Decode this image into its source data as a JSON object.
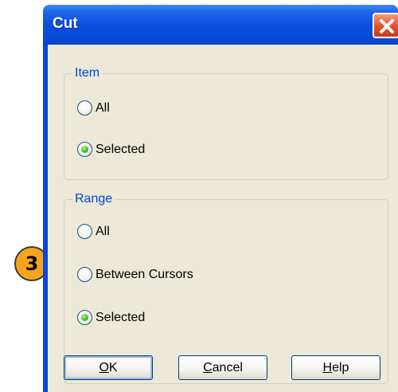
{
  "dialog": {
    "title": "Cut",
    "close_icon": "close-x-icon"
  },
  "item_group": {
    "legend": "Item",
    "options": [
      {
        "label": "All",
        "selected": false
      },
      {
        "label": "Selected",
        "selected": true
      }
    ]
  },
  "range_group": {
    "legend": "Range",
    "options": [
      {
        "label": "All",
        "selected": false
      },
      {
        "label": "Between Cursors",
        "selected": false
      },
      {
        "label": "Selected",
        "selected": true
      }
    ]
  },
  "buttons": {
    "ok": {
      "mnemonic": "O",
      "rest": "K"
    },
    "cancel": {
      "mnemonic": "C",
      "rest": "ancel"
    },
    "help": {
      "mnemonic": "H",
      "rest": "elp"
    }
  },
  "annotation": {
    "number": "3",
    "color": "#f6a51d"
  },
  "colors": {
    "titlebar": "#0b4fe0",
    "client": "#ece9d8",
    "legend_text": "#0046d5",
    "close_button": "#e0502c"
  }
}
